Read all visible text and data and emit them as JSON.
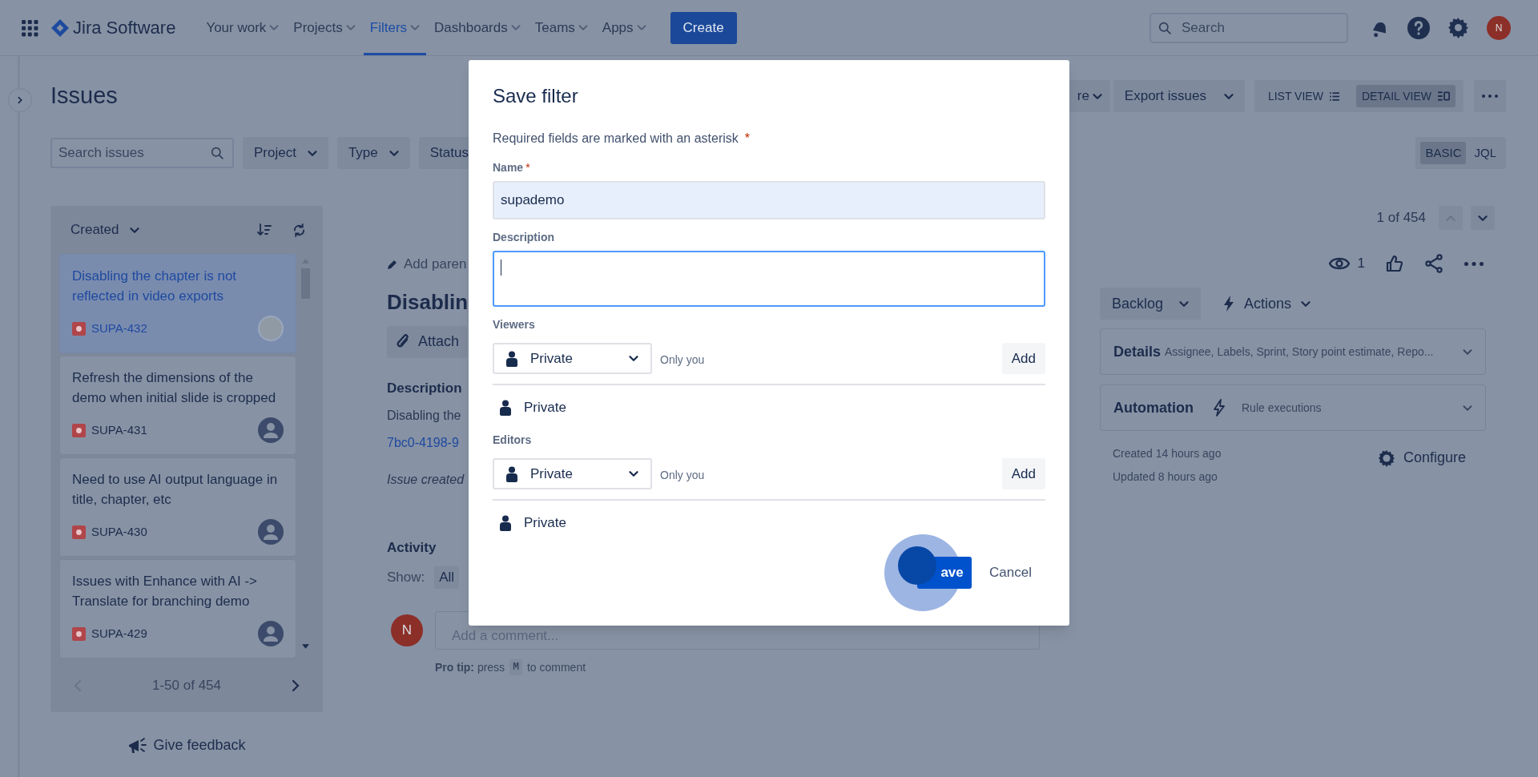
{
  "top_nav": {
    "product_name": "Jira Software",
    "items": [
      {
        "label": "Your work",
        "selected": false
      },
      {
        "label": "Projects",
        "selected": false
      },
      {
        "label": "Filters",
        "selected": true
      },
      {
        "label": "Dashboards",
        "selected": false
      },
      {
        "label": "Teams",
        "selected": false
      },
      {
        "label": "Apps",
        "selected": false
      }
    ],
    "create_button": "Create",
    "search": {
      "placeholder": "Search"
    },
    "avatar": "N"
  },
  "page": {
    "title": "Issues",
    "search": {
      "placeholder": "Search issues"
    },
    "filters": [
      "Project",
      "Type",
      "Status"
    ],
    "actions": [
      "re",
      "Export issues"
    ],
    "views": [
      {
        "label": "LIST VIEW",
        "kind": "list",
        "selected": false
      },
      {
        "label": "DETAIL VIEW",
        "kind": "detail",
        "selected": true
      }
    ],
    "query_modes": [
      {
        "label": "BASIC",
        "selected": true
      },
      {
        "label": "JQL",
        "selected": false
      }
    ]
  },
  "issue_list": {
    "sort": "Created",
    "issues": [
      {
        "title": "Disabling the chapter is not reflected in video exports",
        "key": "SUPA-432",
        "selected": true,
        "kind": "photo"
      },
      {
        "title": "Refresh the dimensions of the demo when initial slide is cropped",
        "key": "SUPA-431",
        "selected": false,
        "kind": "silhouette"
      },
      {
        "title": "Need to use AI output language in title, chapter, etc",
        "key": "SUPA-430",
        "selected": false,
        "kind": "silhouette"
      },
      {
        "title": "Issues with Enhance with AI -> Translate for branching demo",
        "key": "SUPA-429",
        "selected": false,
        "kind": "silhouette"
      }
    ],
    "pagination": {
      "range": "1-50 of 454",
      "previous_disabled": true,
      "next_disabled": false
    }
  },
  "feedback": "Give feedback",
  "issue_detail": {
    "add_parent": "Add paren",
    "title": "Disablin",
    "attach": "Attach",
    "description_heading": "Description",
    "description_text": "Disabling the",
    "description_link": "7bc0-4198-9",
    "created_note": "Issue created",
    "activity_heading": "Activity",
    "show_label": "Show:",
    "show_filter": "All",
    "commenter_avatar": "N",
    "comment": {
      "placeholder": "Add a comment..."
    },
    "pro_tip": {
      "text": "**Pro tip:** press",
      "key": "M",
      "suffix": "to comment"
    },
    "position": "1 of 454",
    "previous_disabled": true,
    "watchers": "1",
    "status": "Backlog",
    "actions": "Actions",
    "panels": [
      {
        "title": "Details",
        "summary": "Assignee, Labels, Sprint, Story point estimate, Repo...",
        "kind": "details"
      },
      {
        "title": "Automation",
        "summary": "Rule executions",
        "kind": "automation"
      }
    ],
    "created": "Created 14 hours ago",
    "updated": "Updated 8 hours ago",
    "configure": "Configure"
  },
  "dialog": {
    "title": "Save filter",
    "required_note": "Required fields are marked with an asterisk",
    "required_mark": "*",
    "name": {
      "label": "Name",
      "required": true,
      "value": "supademo"
    },
    "description": {
      "label": "Description",
      "focused": true
    },
    "sharing": [
      {
        "label": "Viewers",
        "selection": "Private",
        "hint": "Only you",
        "add_button": "Add",
        "entries": [
          "Private"
        ]
      },
      {
        "label": "Editors",
        "selection": "Private",
        "hint": "Only you",
        "add_button": "Add",
        "entries": [
          "Private"
        ]
      }
    ],
    "buttons": [
      {
        "label": "ave",
        "kind": "primary"
      },
      {
        "label": "Cancel",
        "kind": "subtle"
      }
    ]
  }
}
